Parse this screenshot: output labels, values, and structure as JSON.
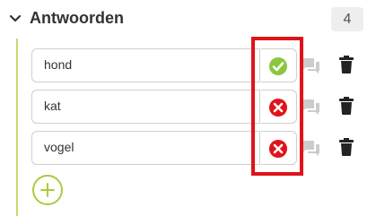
{
  "section": {
    "title": "Antwoorden",
    "count": "4"
  },
  "answers": [
    {
      "text": "hond",
      "status": "correct"
    },
    {
      "text": "kat",
      "status": "incorrect"
    },
    {
      "text": "vogel",
      "status": "incorrect"
    }
  ],
  "icons": {
    "collapse": "chevron-down-icon",
    "correct": "check-circle-icon",
    "incorrect": "x-circle-icon",
    "comment": "comment-icon",
    "delete": "trash-icon",
    "add": "plus-icon"
  },
  "colors": {
    "accent": "#a9cc3f",
    "correct": "#8cc63f",
    "incorrect": "#e0131b",
    "highlight_frame": "#e0131b",
    "comment_icon": "#cccccc",
    "trash_icon": "#222222"
  }
}
